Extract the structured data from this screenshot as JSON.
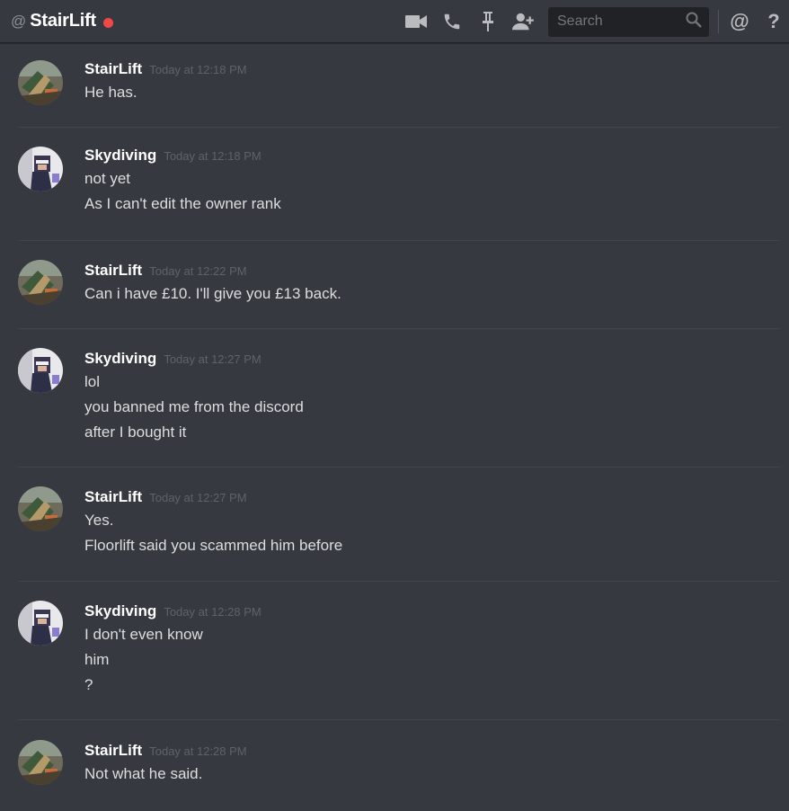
{
  "header": {
    "at_symbol": "@",
    "title": "StairLift",
    "status": "dnd",
    "status_color": "#f04747",
    "icons": [
      "video-call-icon",
      "voice-call-icon",
      "pin-icon",
      "add-friend-icon"
    ],
    "search_placeholder": "Search",
    "right_icons": [
      "mention-icon",
      "help-icon"
    ],
    "mention_glyph": "@",
    "help_glyph": "?"
  },
  "messages": [
    {
      "author": "StairLift",
      "timestamp": "Today at 12:18 PM",
      "avatar": "stairlift",
      "lines": [
        "He has."
      ]
    },
    {
      "author": "Skydiving",
      "timestamp": "Today at 12:18 PM",
      "avatar": "skydiving",
      "lines": [
        "not yet",
        "As I can't edit the owner rank"
      ]
    },
    {
      "author": "StairLift",
      "timestamp": "Today at 12:22 PM",
      "avatar": "stairlift",
      "lines": [
        "Can i have £10. I'll give you £13 back."
      ]
    },
    {
      "author": "Skydiving",
      "timestamp": "Today at 12:27 PM",
      "avatar": "skydiving",
      "lines": [
        "lol",
        "you banned me from the discord",
        "after I bought it"
      ]
    },
    {
      "author": "StairLift",
      "timestamp": "Today at 12:27 PM",
      "avatar": "stairlift",
      "lines": [
        "Yes.",
        "Floorlift said you scammed him before"
      ]
    },
    {
      "author": "Skydiving",
      "timestamp": "Today at 12:28 PM",
      "avatar": "skydiving",
      "lines": [
        "I don't even know",
        "him",
        "?"
      ]
    },
    {
      "author": "StairLift",
      "timestamp": "Today at 12:28 PM",
      "avatar": "stairlift",
      "lines": [
        "Not what he said."
      ]
    }
  ]
}
